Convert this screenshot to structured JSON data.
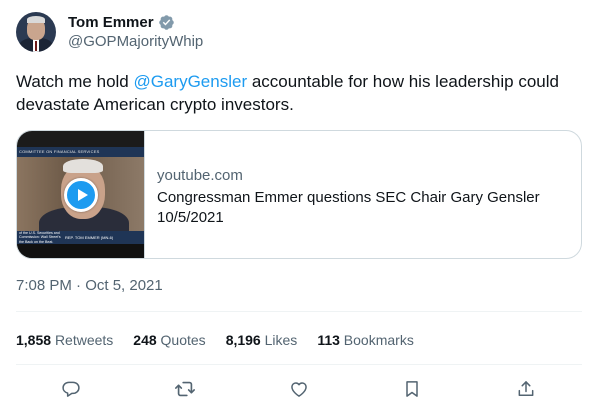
{
  "author": {
    "display_name": "Tom Emmer",
    "handle": "@GOPMajorityWhip",
    "verified": true
  },
  "tweet": {
    "text_before": "Watch me hold ",
    "mention": "@GaryGensler",
    "text_after": " accountable for how his leadership could devastate American crypto investors.",
    "timestamp": "7:08 PM · Oct 5, 2021"
  },
  "card": {
    "domain": "youtube.com",
    "title": "Congressman Emmer questions SEC Chair Gary Gensler 10/5/2021",
    "thumbnail_banner": "COMMITTEE ON FINANCIAL SERVICES",
    "thumbnail_lower_left": "of the U.S. Securities and Commission: Wall Street's the Back on the Beat.",
    "thumbnail_lower_right": "REP. TOM EMMER (MN-6)"
  },
  "stats": [
    {
      "value": "1,858",
      "label": "Retweets"
    },
    {
      "value": "248",
      "label": "Quotes"
    },
    {
      "value": "8,196",
      "label": "Likes"
    },
    {
      "value": "113",
      "label": "Bookmarks"
    }
  ],
  "actions": [
    {
      "icon": "reply-icon"
    },
    {
      "icon": "retweet-icon"
    },
    {
      "icon": "like-icon"
    },
    {
      "icon": "bookmark-icon"
    },
    {
      "icon": "share-icon"
    }
  ],
  "colors": {
    "accent": "#1d9bf0",
    "text": "#0f1419",
    "muted": "#536471",
    "border": "#cfd9de"
  }
}
